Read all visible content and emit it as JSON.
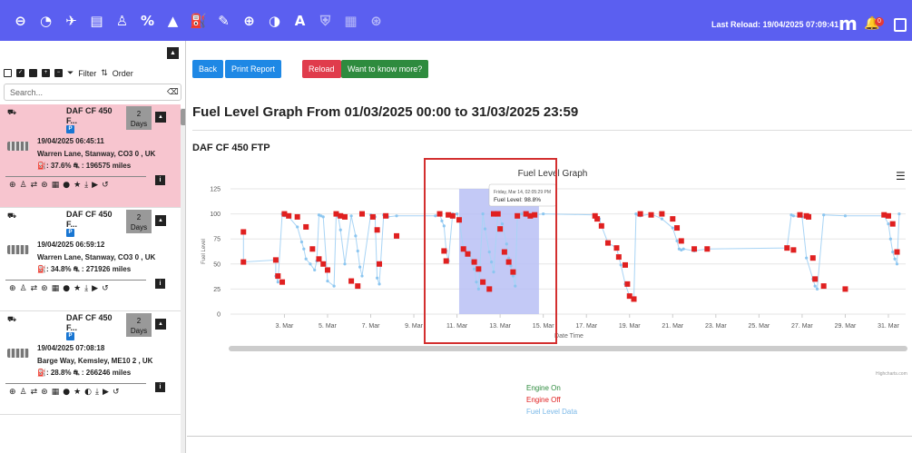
{
  "topbar": {
    "icons": [
      "back-arrow-icon",
      "gauge-icon",
      "map-icon",
      "document-icon",
      "driver-icon",
      "percent-icon",
      "warning-icon",
      "fuel-icon",
      "edit-icon",
      "lifebuoy-icon",
      "speedometer-icon",
      "text-icon",
      "shield-icon",
      "truck-icon",
      "steering-icon"
    ],
    "last_reload": "Last Reload: 19/04/2025 07:09:41",
    "brand": "m",
    "notification_count": "0"
  },
  "sidebar": {
    "filter_label": "Filter",
    "order_label": "Order",
    "search_placeholder": "Search...",
    "vehicles": [
      {
        "name": "DAF CF 450",
        "sub": "F...",
        "badge": "P",
        "days": "2",
        "days_unit": "Days",
        "time": "19/04/2025 06:45:11",
        "address": "Warren Lane, Stanway, CO3 0 , UK",
        "stats": ": 37.6% ⛐ : 196575 miles",
        "selected": true
      },
      {
        "name": "DAF CF 450",
        "sub": "F...",
        "badge": "P",
        "days": "2",
        "days_unit": "Days",
        "time": "19/04/2025 06:59:12",
        "address": "Warren Lane, Stanway, CO3 0 , UK",
        "stats": ": 34.8% ⛐ : 271926 miles",
        "selected": false
      },
      {
        "name": "DAF CF 450",
        "sub": "F...",
        "badge": "P",
        "days": "2",
        "days_unit": "Days",
        "time": "19/04/2025 07:08:18",
        "address": "Barge Way, Kemsley, ME10 2 , UK",
        "stats": ": 28.8% ⛐ : 266246 miles",
        "selected": false
      }
    ]
  },
  "main": {
    "back_label": "Back",
    "print_label": "Print Report",
    "reload_label": "Reload",
    "know_more_label": "Want to know more?",
    "page_title": "Fuel Level Graph From 01/03/2025 00:00 to 31/03/2025 23:59",
    "vehicle_title": "DAF CF 450 FTP",
    "credits": "Highcharts.com",
    "legend": {
      "engine_on": "Engine On",
      "engine_off": "Engine Off",
      "fuel_level": "Fuel Level Data"
    }
  },
  "colors": {
    "topbar": "#5b5ff0",
    "engine_on": "#2e8b3e",
    "engine_off": "#e02020",
    "fuel_line": "#a8d4f5",
    "selection": "#b8bff5"
  },
  "chart_data": {
    "type": "line",
    "title": "Fuel Level Graph",
    "xlabel": "Date Time",
    "ylabel": "Fuel Level",
    "ylim": [
      0,
      125
    ],
    "yticks": [
      "0",
      "25",
      "50",
      "75",
      "100",
      "125"
    ],
    "xticks": [
      "3. Mar",
      "5. Mar",
      "7. Mar",
      "9. Mar",
      "11. Mar",
      "13. Mar",
      "15. Mar",
      "17. Mar",
      "19. Mar",
      "21. Mar",
      "23. Mar",
      "25. Mar",
      "27. Mar",
      "29. Mar",
      "31. Mar"
    ],
    "tooltip": {
      "date": "Friday, Mar 14, 02:05:29 PM",
      "label": "Fuel Level: 98.8%"
    },
    "selection": [
      11.1,
      14.8
    ],
    "series": [
      {
        "name": "Fuel Level Data",
        "x": [
          1.1,
          1.1,
          2.6,
          2.6,
          2.7,
          2.9,
          3.0,
          3.2,
          3.6,
          3.8,
          3.9,
          4.0,
          4.2,
          4.4,
          4.5,
          4.6,
          4.7,
          4.8,
          5.0,
          5.3,
          5.4,
          5.5,
          5.6,
          5.8,
          6.1,
          6.3,
          6.4,
          6.5,
          6.6,
          7.0,
          7.2,
          7.3,
          7.4,
          7.6,
          7.8,
          8.2,
          10.0,
          10.2,
          10.3,
          10.4,
          10.5,
          10.6,
          10.8,
          11.0,
          11.1,
          11.3,
          11.5,
          11.6,
          11.7,
          11.8,
          11.9,
          12.0,
          12.2,
          12.3,
          12.5,
          12.6,
          12.7,
          12.9,
          13.1,
          13.3,
          13.4,
          13.5,
          13.6,
          13.7,
          13.8,
          14.0,
          14.2,
          14.3,
          14.6,
          15.0,
          17.4,
          17.6,
          17.7,
          18.0,
          18.4,
          18.5,
          18.6,
          18.8,
          19.0,
          19.2,
          19.3,
          19.4,
          19.5,
          20.0,
          20.5,
          21.0,
          21.2,
          21.3,
          21.4,
          21.5,
          22.0,
          22.6,
          26.3,
          26.5,
          26.6,
          27.0,
          27.2,
          27.5,
          27.6,
          27.7,
          28.0,
          29.0,
          30.8,
          31.0,
          31.1,
          31.2,
          31.3,
          31.4,
          31.5
        ],
        "y": [
          82,
          52,
          54,
          38,
          32,
          100,
          98,
          97,
          87,
          72,
          65,
          55,
          50,
          44,
          53,
          99,
          98,
          97,
          33,
          28,
          100,
          97,
          84,
          50,
          98,
          78,
          63,
          47,
          38,
          99,
          97,
          36,
          30,
          99,
          97,
          98,
          98,
          100,
          93,
          88,
          63,
          53,
          100,
          100,
          94,
          65,
          60,
          61,
          52,
          45,
          32,
          25,
          100,
          85,
          62,
          52,
          42,
          101,
          90,
          70,
          56,
          48,
          38,
          28,
          98,
          100,
          98,
          99,
          99,
          100,
          99,
          95,
          88,
          71,
          66,
          57,
          49,
          30,
          18,
          15,
          100,
          99,
          98,
          100,
          95,
          86,
          73,
          65,
          64,
          65,
          63,
          65,
          66,
          99,
          98,
          97,
          56,
          35,
          28,
          25,
          99,
          98,
          98,
          90,
          75,
          62,
          55,
          50,
          100
        ]
      },
      {
        "name": "Engine Off",
        "x": [
          1.1,
          1.1,
          2.6,
          2.7,
          2.9,
          3.0,
          3.2,
          3.6,
          4.0,
          4.3,
          4.6,
          4.8,
          5.0,
          5.4,
          5.6,
          5.8,
          6.1,
          6.4,
          6.6,
          7.1,
          7.3,
          7.4,
          7.7,
          8.2,
          10.2,
          10.4,
          10.5,
          10.6,
          10.8,
          11.1,
          11.3,
          11.5,
          11.8,
          12.0,
          12.2,
          12.5,
          12.7,
          12.9,
          13.0,
          13.2,
          13.4,
          13.6,
          13.8,
          14.2,
          14.4,
          14.6,
          17.4,
          17.5,
          17.7,
          18.0,
          18.4,
          18.5,
          18.8,
          18.9,
          19.0,
          19.2,
          19.5,
          20.0,
          20.5,
          21.0,
          21.2,
          21.4,
          22.0,
          22.6,
          26.3,
          26.6,
          26.9,
          27.2,
          27.3,
          27.5,
          27.6,
          28.0,
          29.0,
          30.8,
          31.0,
          31.2,
          31.4
        ],
        "y": [
          82,
          52,
          54,
          38,
          32,
          100,
          98,
          97,
          87,
          65,
          55,
          50,
          44,
          100,
          98,
          97,
          33,
          28,
          100,
          97,
          84,
          50,
          98,
          78,
          100,
          63,
          53,
          99,
          98,
          94,
          65,
          60,
          52,
          45,
          32,
          25,
          100,
          100,
          85,
          62,
          52,
          42,
          98,
          100,
          98,
          99,
          98,
          95,
          88,
          71,
          66,
          57,
          49,
          30,
          18,
          15,
          100,
          99,
          100,
          95,
          86,
          73,
          65,
          65,
          66,
          64,
          99,
          98,
          97,
          56,
          35,
          28,
          25,
          99,
          98,
          90,
          62
        ]
      }
    ]
  }
}
